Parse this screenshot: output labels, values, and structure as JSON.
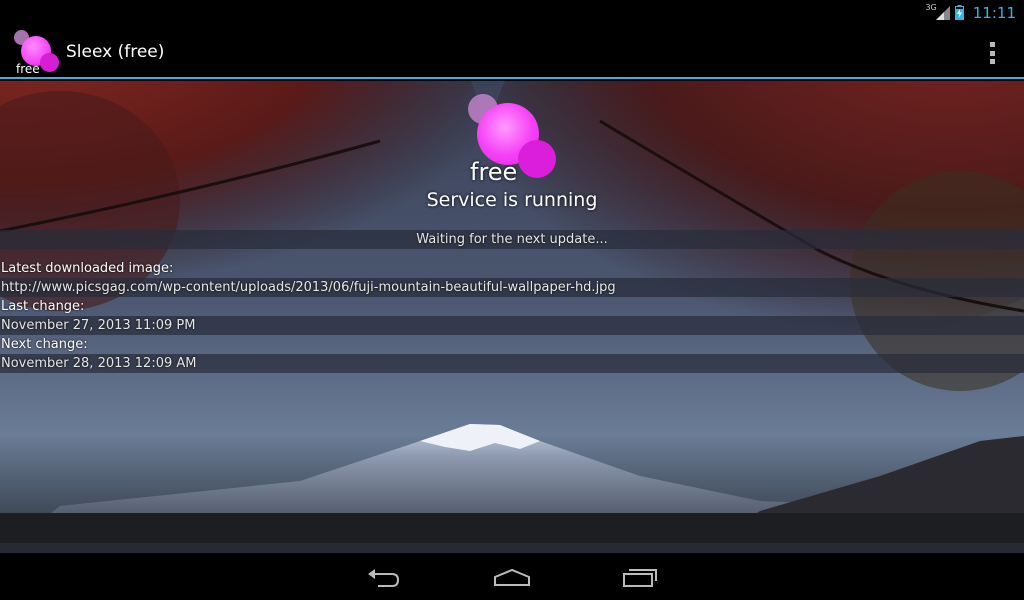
{
  "status_bar": {
    "network_type": "3G",
    "time": "11:11",
    "icons": [
      "signal-icon",
      "battery-charging-icon"
    ]
  },
  "action_bar": {
    "logo_text": "free",
    "title": "Sleex (free)",
    "overflow_icon": "overflow-menu-icon"
  },
  "main": {
    "logo_text": "free",
    "service_status": "Service is running",
    "waiting_text": "Waiting for the next update...",
    "latest_image_label": "Latest downloaded image:",
    "latest_image_url": "http://www.picsgag.com/wp-content/uploads/2013/06/fuji-mountain-beautiful-wallpaper-hd.jpg",
    "last_change_label": "Last change:",
    "last_change_value": "November 27, 2013 11:09 PM",
    "next_change_label": "Next change:",
    "next_change_value": "November 28, 2013 12:09 AM"
  },
  "nav_bar": {
    "icons": [
      "back-icon",
      "home-icon",
      "recent-apps-icon"
    ]
  },
  "colors": {
    "accent": "#33b5e5",
    "logo_pink": "#f545f5",
    "background": "#000000"
  }
}
